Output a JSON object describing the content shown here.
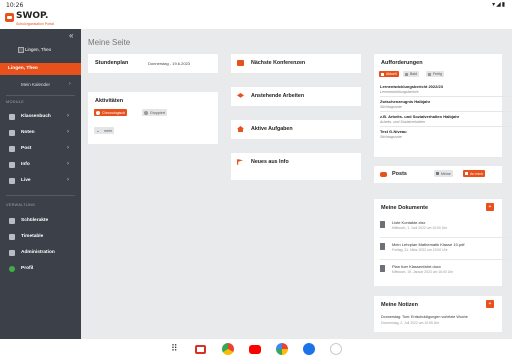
{
  "statusbar": {
    "time": "10:26",
    "icons": "▾◢▮"
  },
  "brand": {
    "name": "SWOP.",
    "tagline": "Schulorganisation Portal"
  },
  "sidebar": {
    "collapse_icon": "«",
    "avatar_alt": "Lingen, Theo",
    "user": "Lingen, Theo",
    "calendar": "Mein Kalender",
    "module_label": "MODULE",
    "modules": [
      {
        "label": "Klassenbuch",
        "icon": "book-icon"
      },
      {
        "label": "Noten",
        "icon": "grades-icon"
      },
      {
        "label": "Post",
        "icon": "mail-icon"
      },
      {
        "label": "Info",
        "icon": "info-icon"
      },
      {
        "label": "Live",
        "icon": "live-icon"
      }
    ],
    "admin_label": "VERWALTUNG",
    "admin": [
      {
        "label": "Schülerakte",
        "icon": "folder-icon"
      },
      {
        "label": "Timetable",
        "icon": "timetable-icon"
      },
      {
        "label": "Administration",
        "icon": "admin-icon"
      },
      {
        "label": "Profil",
        "icon": "profile-icon"
      }
    ]
  },
  "main": {
    "title": "Meine Seite",
    "stundenplan": {
      "title": "Stundenplan",
      "date": "Donnerstag - 19.6.2023"
    },
    "aktivitaeten": {
      "title": "Aktivitäten",
      "chip_active": "Chronologisch",
      "chip_inactive": "Gruppiert",
      "more": "mehr"
    },
    "mid_cards": [
      {
        "label": "Nächste Konferenzen",
        "icon": "video-icon"
      },
      {
        "label": "Anstehende Arbeiten",
        "icon": "graduation-cap-icon"
      },
      {
        "label": "Aktive Aufgaben",
        "icon": "house-icon"
      },
      {
        "label": "Neues aus Info",
        "icon": "flag-icon"
      }
    ],
    "aufforderungen": {
      "title": "Aufforderungen",
      "chips": [
        "Aktuell",
        "Bald",
        "Fertig"
      ],
      "items": [
        {
          "title": "Lernentwicklungsbericht 2022/23",
          "sub": "Lernentwicklungsbericht"
        },
        {
          "title": "Zwischenzeugnis Halbjahr",
          "sub": "Stichtagsnote"
        },
        {
          "title": "z.B. Arbeits- und Sozialverhalten Halbjahr",
          "sub": "Arbeits- und Sozialverhalten"
        },
        {
          "title": "Test G-Niveau",
          "sub": "Stichtagsnote"
        }
      ]
    },
    "posts": {
      "title": "Posts",
      "seg_inactive": "Meine",
      "seg_active": "An mich"
    },
    "dokumente": {
      "title": "Meine Dokumente",
      "add": "+",
      "files": [
        {
          "name": "Liste Kontakte.xlsx",
          "date": "Mittwoch, 1. Juni 2022 um 10:00 Uhr"
        },
        {
          "name": "Mein Lehrplan Mathematik Klasse 10.pdf",
          "date": "Freitag, 31. März 2022 um 19:00 Uhr"
        },
        {
          "name": "Plan fuer Klassenfahrt.docx",
          "date": "Mittwoch, 19. Januar 2023 um 16:00 Uhr"
        }
      ]
    },
    "notizen": {
      "title": "Meine Notizen",
      "add": "+",
      "note": "Donnerstag: Tom: Entschuldigungen vorletzte Woche",
      "note_date": "Donnerstag, 2. Juli 2022 um 10:55 Uhr"
    }
  },
  "dock": {
    "apps": [
      "apps-grid-icon",
      "gmail-icon",
      "chrome-icon",
      "youtube-icon",
      "photos-icon",
      "messages-icon",
      "swop-app-icon"
    ]
  },
  "colors": {
    "accent": "#e8501c",
    "sidebar": "#3c4149",
    "background": "#e9eaec"
  }
}
